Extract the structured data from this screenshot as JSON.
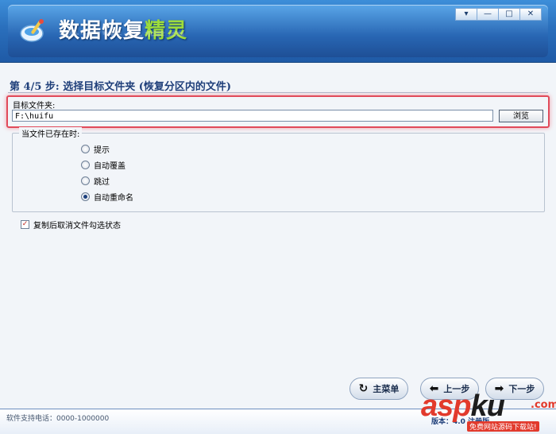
{
  "window": {
    "title_main": "数据恢复",
    "title_accent": "精灵",
    "controls": [
      "▾",
      "—",
      "□",
      "✕"
    ]
  },
  "step": {
    "title": "第 4/5 步: 选择目标文件夹 (恢复分区内的文件)"
  },
  "target": {
    "label": "目标文件夹:",
    "value": "F:\\huifu",
    "browse_label": "浏览"
  },
  "exists_group": {
    "legend": "当文件已存在时:",
    "options": [
      {
        "label": "提示",
        "selected": false
      },
      {
        "label": "自动覆盖",
        "selected": false
      },
      {
        "label": "跳过",
        "selected": false
      },
      {
        "label": "自动重命名",
        "selected": true
      }
    ]
  },
  "checkbox": {
    "label": "复制后取消文件勾选状态",
    "checked": true
  },
  "buttons": {
    "main_menu": "主菜单",
    "prev": "上一步",
    "next": "下一步"
  },
  "status": {
    "left": "软件支持电话：0000-1000000",
    "right": "版本：4.0 注册版"
  },
  "watermark": {
    "brand_a": "asp",
    "brand_b": "ku",
    "dot": ".com",
    "sub": "免费网站源码下载站!"
  },
  "colors": {
    "banner": "#2a6fbc",
    "accent_title": "#9ddc3c",
    "highlight_border": "#e14a5a",
    "watermark_red": "#e23a2c"
  }
}
